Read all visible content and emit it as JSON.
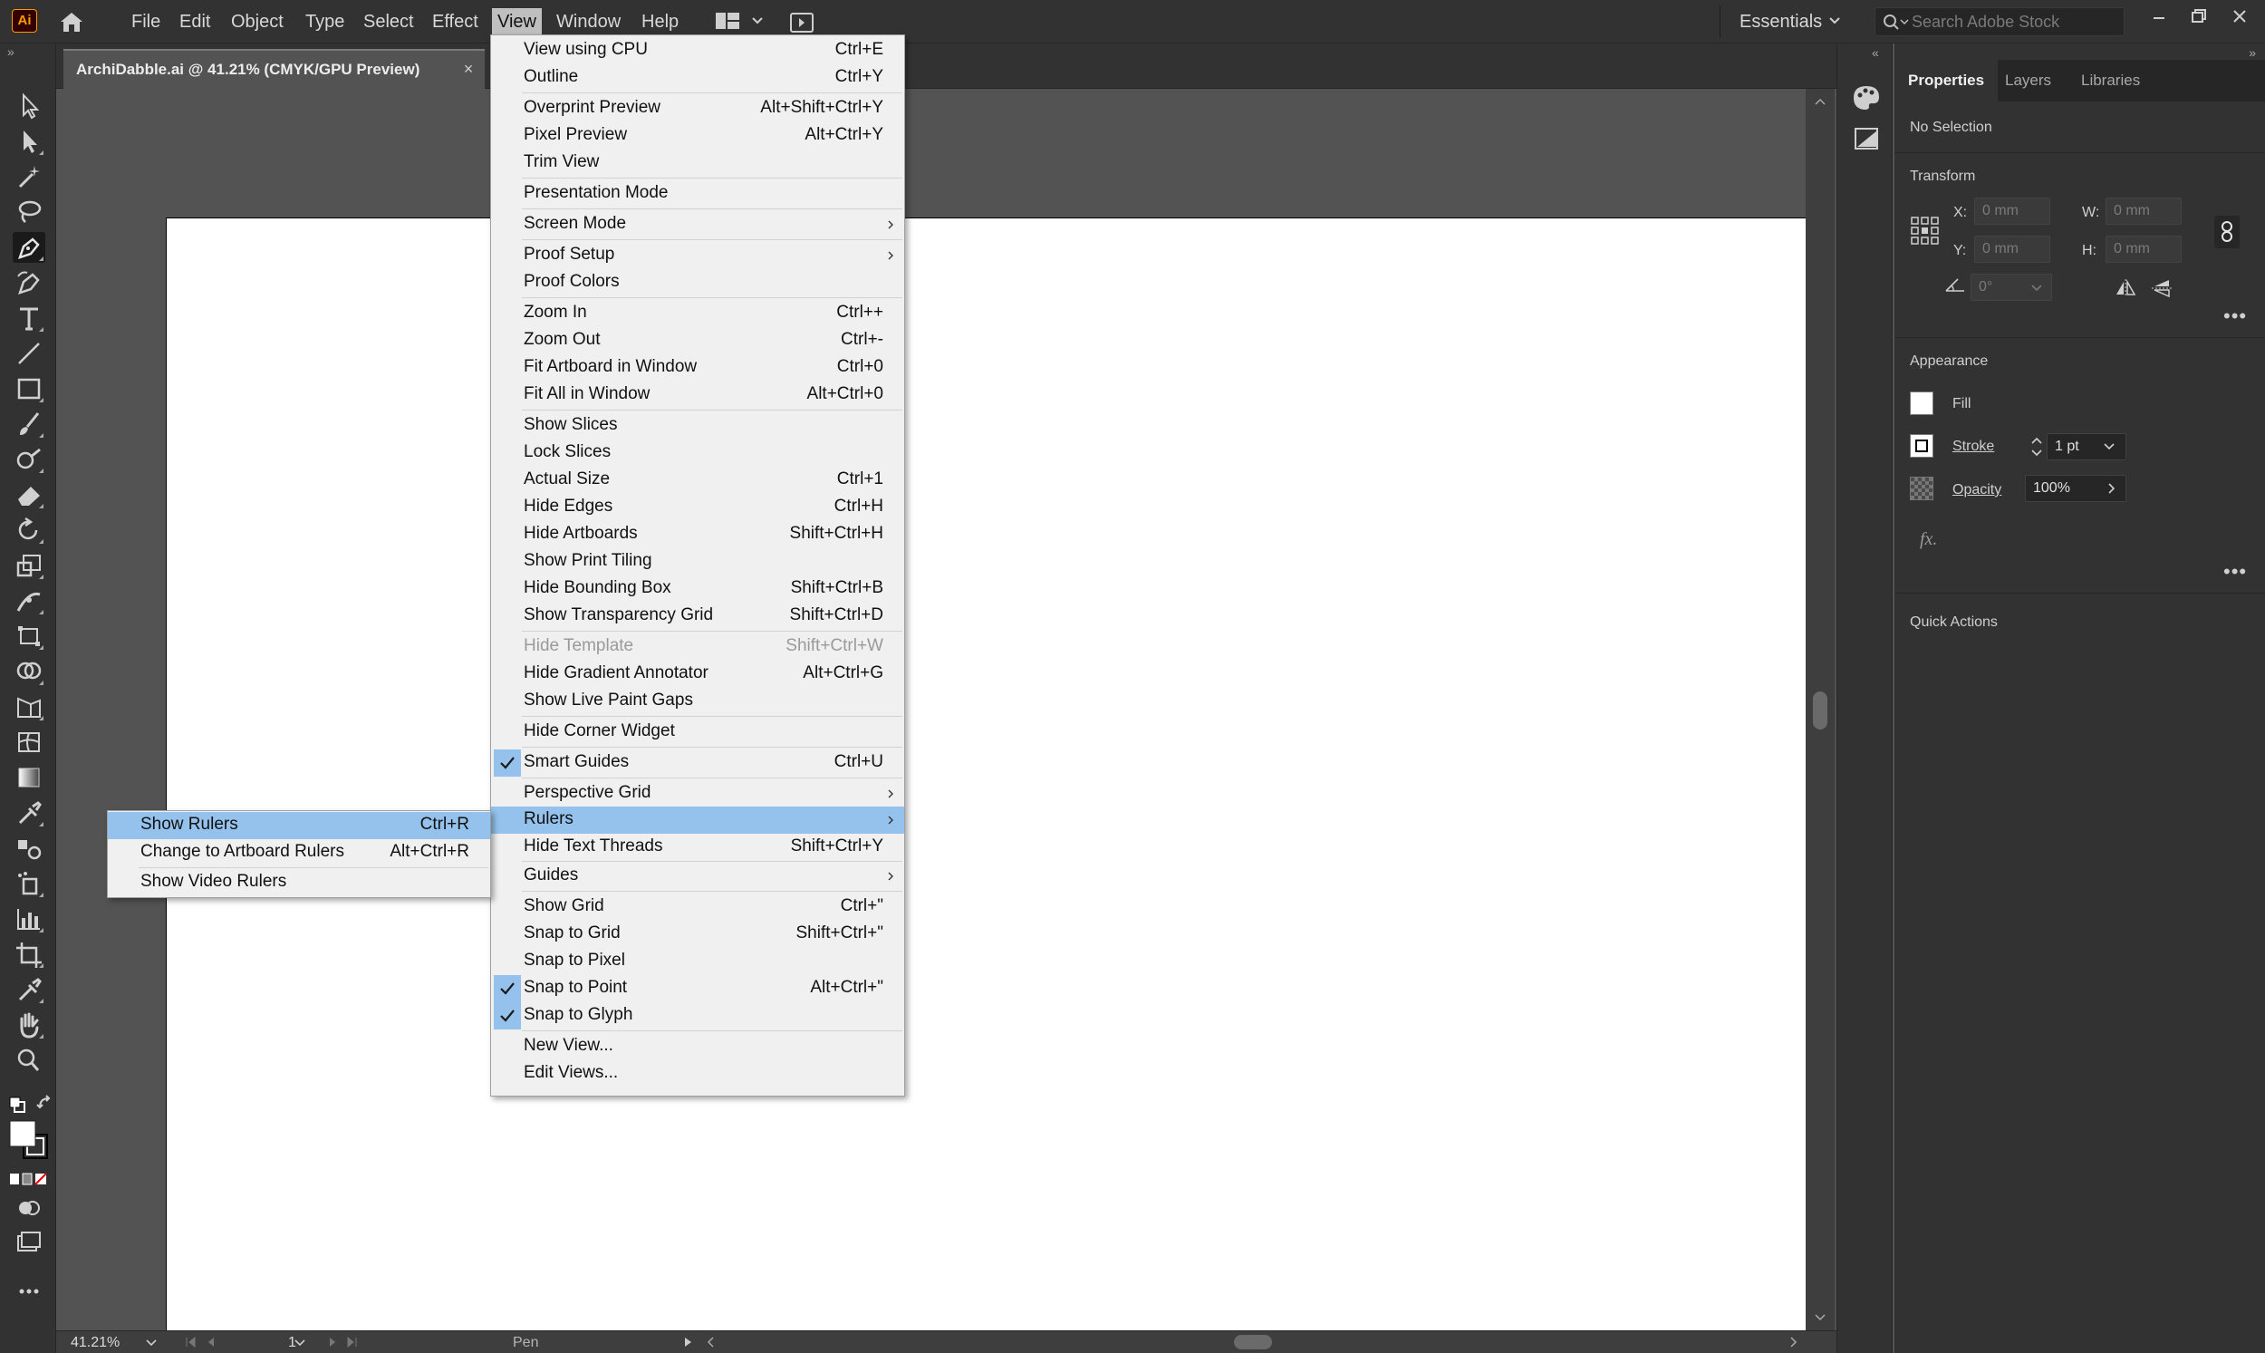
{
  "app": {
    "logo_text": "Ai"
  },
  "menubar": {
    "items": [
      "File",
      "Edit",
      "Object",
      "Type",
      "Select",
      "Effect",
      "View",
      "Window",
      "Help"
    ],
    "active": "View",
    "workspace": "Essentials",
    "search_placeholder": "Search Adobe Stock"
  },
  "document": {
    "tab_title": "ArchiDabble.ai @ 41.21% (CMYK/GPU Preview)",
    "close_glyph": "×"
  },
  "status": {
    "zoom": "41.21%",
    "page": "1",
    "tool": "Pen"
  },
  "panel": {
    "tabs": [
      "Properties",
      "Layers",
      "Libraries"
    ],
    "active_tab": "Properties",
    "selection": "No Selection",
    "transform": {
      "title": "Transform",
      "x_label": "X:",
      "y_label": "Y:",
      "w_label": "W:",
      "h_label": "H:",
      "x": "0 mm",
      "y": "0 mm",
      "w": "0 mm",
      "h": "0 mm",
      "angle": "0°"
    },
    "appearance": {
      "title": "Appearance",
      "fill_label": "Fill",
      "stroke_label": "Stroke",
      "stroke_value": "1 pt",
      "opacity_label": "Opacity",
      "opacity_value": "100%",
      "fx_label": "fx."
    },
    "quick_actions": "Quick Actions"
  },
  "view_menu": {
    "items": [
      {
        "label": "View using CPU",
        "shortcut": "Ctrl+E"
      },
      {
        "label": "Outline",
        "shortcut": "Ctrl+Y"
      },
      {
        "label": "Overprint Preview",
        "shortcut": "Alt+Shift+Ctrl+Y"
      },
      {
        "label": "Pixel Preview",
        "shortcut": "Alt+Ctrl+Y"
      },
      {
        "label": "Trim View",
        "shortcut": ""
      },
      {
        "label": "Presentation Mode",
        "shortcut": ""
      },
      {
        "label": "Screen Mode",
        "shortcut": "",
        "submenu": true
      },
      {
        "label": "Proof Setup",
        "shortcut": "",
        "submenu": true
      },
      {
        "label": "Proof Colors",
        "shortcut": ""
      },
      {
        "label": "Zoom In",
        "shortcut": "Ctrl++"
      },
      {
        "label": "Zoom Out",
        "shortcut": "Ctrl+-"
      },
      {
        "label": "Fit Artboard in Window",
        "shortcut": "Ctrl+0"
      },
      {
        "label": "Fit All in Window",
        "shortcut": "Alt+Ctrl+0"
      },
      {
        "label": "Show Slices",
        "shortcut": ""
      },
      {
        "label": "Lock Slices",
        "shortcut": ""
      },
      {
        "label": "Actual Size",
        "shortcut": "Ctrl+1"
      },
      {
        "label": "Hide Edges",
        "shortcut": "Ctrl+H"
      },
      {
        "label": "Hide Artboards",
        "shortcut": "Shift+Ctrl+H"
      },
      {
        "label": "Show Print Tiling",
        "shortcut": ""
      },
      {
        "label": "Hide Bounding Box",
        "shortcut": "Shift+Ctrl+B"
      },
      {
        "label": "Show Transparency Grid",
        "shortcut": "Shift+Ctrl+D"
      },
      {
        "label": "Hide Template",
        "shortcut": "Shift+Ctrl+W",
        "disabled": true
      },
      {
        "label": "Hide Gradient Annotator",
        "shortcut": "Alt+Ctrl+G"
      },
      {
        "label": "Show Live Paint Gaps",
        "shortcut": ""
      },
      {
        "label": "Hide Corner Widget",
        "shortcut": ""
      },
      {
        "label": "Smart Guides",
        "shortcut": "Ctrl+U",
        "checked": true
      },
      {
        "label": "Perspective Grid",
        "shortcut": "",
        "submenu": true
      },
      {
        "label": "Rulers",
        "shortcut": "",
        "submenu": true,
        "highlighted": true
      },
      {
        "label": "Hide Text Threads",
        "shortcut": "Shift+Ctrl+Y"
      },
      {
        "label": "Guides",
        "shortcut": "",
        "submenu": true
      },
      {
        "label": "Show Grid",
        "shortcut": "Ctrl+\""
      },
      {
        "label": "Snap to Grid",
        "shortcut": "Shift+Ctrl+\""
      },
      {
        "label": "Snap to Pixel",
        "shortcut": ""
      },
      {
        "label": "Snap to Point",
        "shortcut": "Alt+Ctrl+\"",
        "checked": true
      },
      {
        "label": "Snap to Glyph",
        "shortcut": "",
        "checked": true
      },
      {
        "label": "New View...",
        "shortcut": ""
      },
      {
        "label": "Edit Views...",
        "shortcut": ""
      }
    ]
  },
  "rulers_submenu": {
    "items": [
      {
        "label": "Show Rulers",
        "shortcut": "Ctrl+R",
        "highlighted": true
      },
      {
        "label": "Change to Artboard Rulers",
        "shortcut": "Alt+Ctrl+R"
      },
      {
        "label": "Show Video Rulers",
        "shortcut": ""
      }
    ]
  },
  "colors": {
    "menu_highlight": "#94c2ec",
    "menu_bg": "#f0f0f0",
    "chrome_dark": "#323232",
    "canvas": "#535353",
    "logo_orange": "#ff9a00"
  }
}
